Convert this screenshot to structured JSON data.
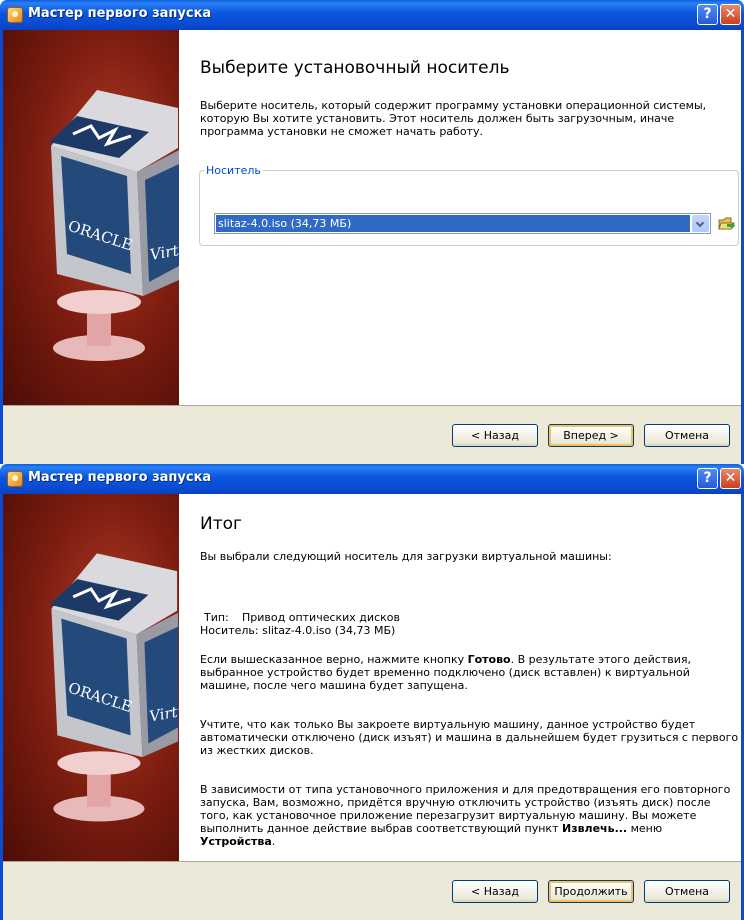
{
  "window1": {
    "title": "Мастер первого запуска",
    "heading": "Выберите установочный носитель",
    "description": "Выберите носитель, который содержит программу установки операционной системы, которую Вы хотите установить. Этот носитель должен быть загрузочным, иначе программа установки не сможет начать работу.",
    "media_group_label": "Носитель",
    "media_value": "slitaz-4.0.iso (34,73 МБ)",
    "buttons": {
      "back": "< Назад",
      "next": "Вперед >",
      "cancel": "Отмена"
    }
  },
  "window2": {
    "title": "Мастер первого запуска",
    "heading": "Итог",
    "intro": "Вы выбрали следующий носитель для загрузки виртуальной машины:",
    "type_key": "Тип:",
    "type_value": "Привод оптических дисков",
    "media_key": "Носитель:",
    "media_value": "slitaz-4.0.iso (34,73 МБ)",
    "p1_before": "Если вышесказанное верно, нажмите кнопку ",
    "p1_bold": "Готово",
    "p1_after": ". В результате этого действия, выбранное устройство будет временно подключено (диск вставлен) к виртуальной машине, после чего машина будет запущена.",
    "p2": "Учтите, что как только Вы закроете виртуальную машину, данное устройство будет автоматически отключено (диск изъят) и машина в дальнейшем будет грузиться с первого из жестких дисков.",
    "p3_before": "В зависимости от типа установочного приложения и для предотвращения его повторного запуска, Вам, возможно, придётся вручную отключить устройство (изъять диск) после того, как установочное приложение перезагрузит виртуальную машину. Вы можете выполнить данное действие выбрав соответствующий пункт ",
    "p3_bold1": "Извлечь...",
    "p3_mid": " меню ",
    "p3_bold2": "Устройства",
    "p3_after": ".",
    "buttons": {
      "back": "< Назад",
      "continue": "Продолжить",
      "cancel": "Отмена"
    }
  },
  "titlebar_buttons": {
    "help": "?",
    "close": "✕"
  },
  "logo": {
    "text1": "ORACLE",
    "text2": "Virtu"
  },
  "colors": {
    "titlebar": "#0a4bd4",
    "selection": "#316ac5",
    "button_face": "#ece9d8",
    "group_label": "#0046d5",
    "side_panel": "#7d1d10"
  }
}
